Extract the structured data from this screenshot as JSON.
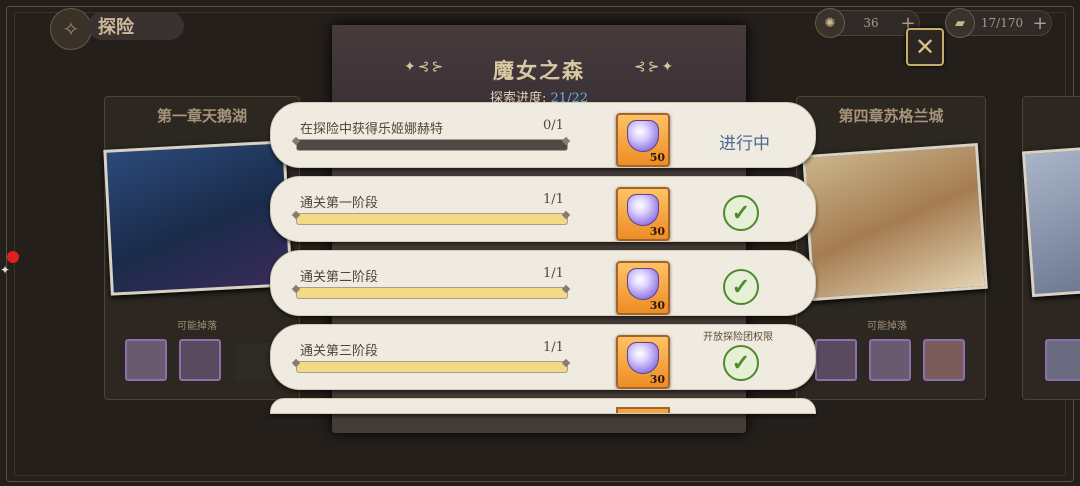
{
  "header": {
    "title": "探险"
  },
  "resources": [
    {
      "icon": "gear-token-icon",
      "value": "36"
    },
    {
      "icon": "ticket-icon",
      "value": "17/170"
    }
  ],
  "chapters": [
    {
      "title": "第一章天鹅湖",
      "drops_label": "可能掉落"
    },
    {
      "title": "第四章苏格兰城",
      "drops_label": "可能掉落"
    }
  ],
  "panel": {
    "title": "魔女之森",
    "progress_label": "探索进度:",
    "progress_value": "21/22"
  },
  "tasks": [
    {
      "name": "在探险中获得乐姬娜赫特",
      "count": "0/1",
      "progress": 0,
      "reward_qty": "50",
      "status": "进行中",
      "note": ""
    },
    {
      "name": "通关第一阶段",
      "count": "1/1",
      "progress": 1,
      "reward_qty": "30",
      "status": "completed",
      "note": ""
    },
    {
      "name": "通关第二阶段",
      "count": "1/1",
      "progress": 1,
      "reward_qty": "30",
      "status": "completed",
      "note": ""
    },
    {
      "name": "通关第三阶段",
      "count": "1/1",
      "progress": 1,
      "reward_qty": "30",
      "status": "completed",
      "note": "开放探险团权限"
    }
  ],
  "colors": {
    "accent_gold": "#d9c9a3",
    "progress_blue": "#6cb0e6",
    "bar_fill": "#f2da87",
    "check_green": "#4e8a2c"
  }
}
